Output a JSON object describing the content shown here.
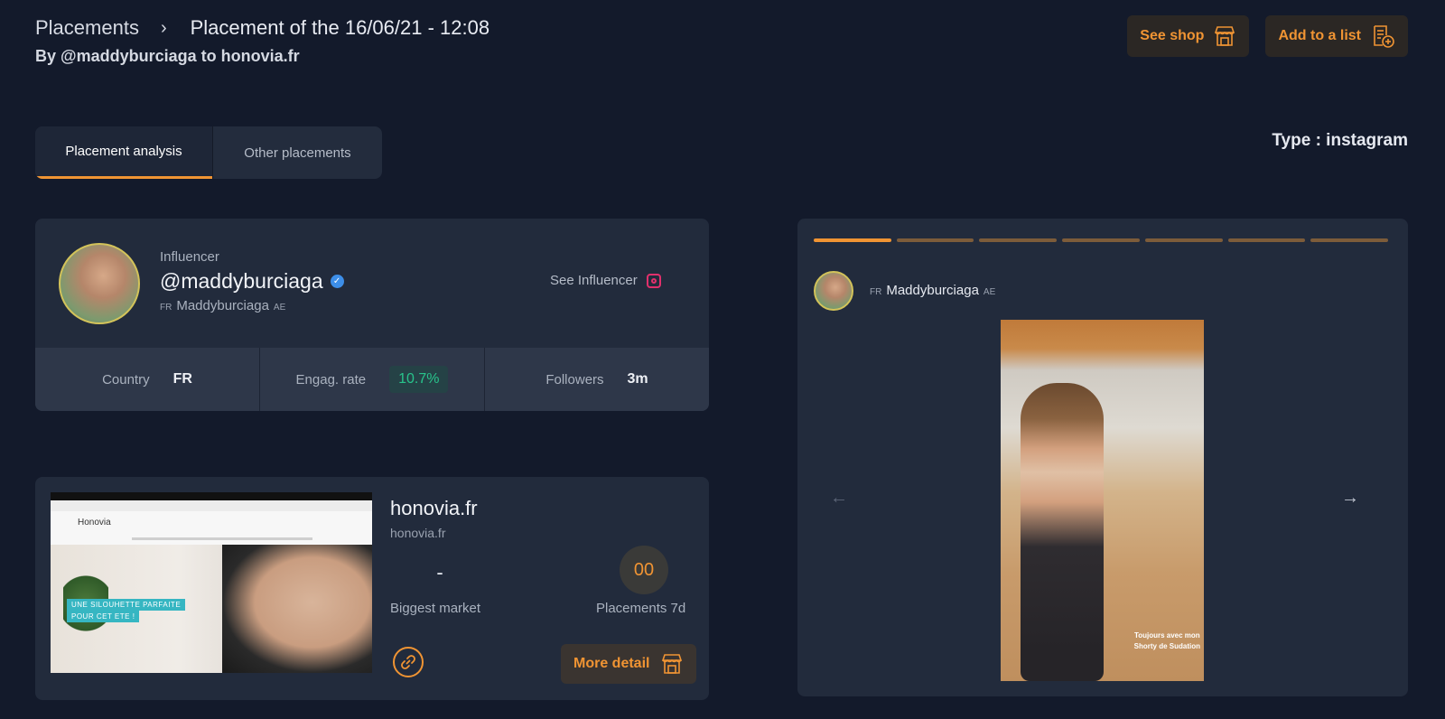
{
  "breadcrumb": {
    "parent": "Placements",
    "separator": "›",
    "current": "Placement of the 16/06/21 - 12:08"
  },
  "subtitle": "By @maddyburciaga to honovia.fr",
  "actions": {
    "see_shop": "See shop",
    "add_to_list": "Add to a list"
  },
  "tabs": [
    {
      "label": "Placement analysis",
      "active": true
    },
    {
      "label": "Other placements",
      "active": false
    }
  ],
  "type_label": "Type : instagram",
  "influencer": {
    "label": "Influencer",
    "handle": "@maddyburciaga",
    "name_prefix": "FR",
    "name": "Maddyburciaga",
    "name_suffix": "AE",
    "see_influencer": "See Influencer",
    "stats": {
      "country_label": "Country",
      "country_value": "FR",
      "engagement_label": "Engag. rate",
      "engagement_value": "10.7%",
      "followers_label": "Followers",
      "followers_value": "3m"
    }
  },
  "shop": {
    "title": "honovia.fr",
    "domain": "honovia.fr",
    "biggest_market_value": "-",
    "biggest_market_label": "Biggest market",
    "placements_value": "00",
    "placements_label": "Placements 7d",
    "more_detail": "More detail",
    "thumbnail": {
      "logo": "Honovia",
      "banner_line1": "UNE SILOUHETTE PARFAITE",
      "banner_line2": "POUR CET ETE !"
    }
  },
  "story": {
    "segments_total": 7,
    "active_segment": 1,
    "name_prefix": "FR",
    "name": "Maddyburciaga",
    "name_suffix": "AE",
    "caption_line1": "Toujours avec mon",
    "caption_line2": "Shorty de Sudation"
  },
  "colors": {
    "background": "#131a2b",
    "card": "#222b3c",
    "accent": "#f09433",
    "positive": "#28c38b"
  }
}
